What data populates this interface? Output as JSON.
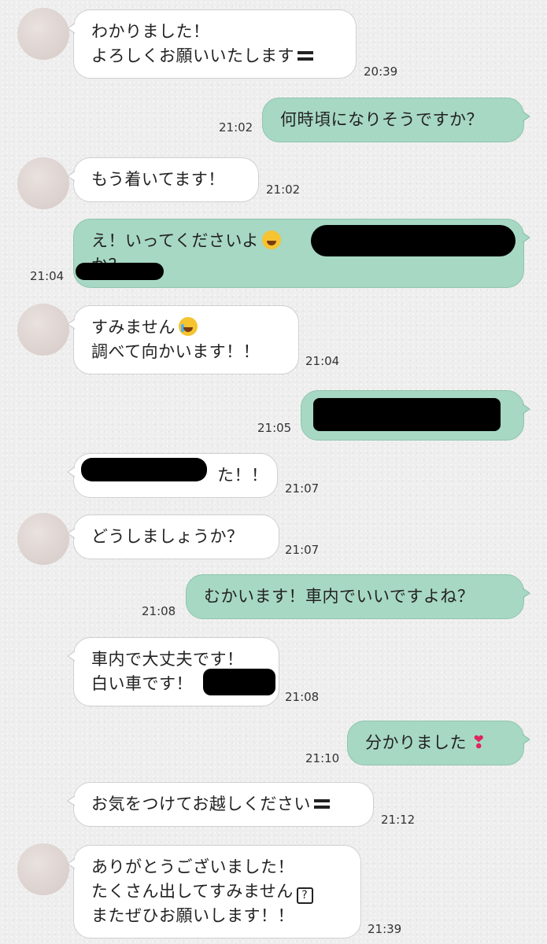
{
  "messages": [
    {
      "lines": [
        "わかりました！",
        "よろしくお願いいたします"
      ],
      "time": "20:39"
    },
    {
      "lines": [
        "何時頃になりそうですか？"
      ],
      "time": "21:02"
    },
    {
      "lines": [
        "もう着いてます！"
      ],
      "time": "21:02"
    },
    {
      "lines": [
        "え！いってくださいよ",
        "か？"
      ],
      "time": "21:04"
    },
    {
      "lines": [
        "すみません",
        "調べて向かいます！！"
      ],
      "time": "21:04"
    },
    {
      "lines": [
        ""
      ],
      "time": "21:05"
    },
    {
      "lines": [
        "た！！"
      ],
      "time": "21:07"
    },
    {
      "lines": [
        "どうしましょうか？"
      ],
      "time": "21:07"
    },
    {
      "lines": [
        "むかいます！車内でいいですよね？"
      ],
      "time": "21:08"
    },
    {
      "lines": [
        "車内で大丈夫です！",
        "白い車です！"
      ],
      "time": "21:08"
    },
    {
      "lines": [
        "分かりました"
      ],
      "time": "21:10"
    },
    {
      "lines": [
        "お気をつけてお越しください"
      ],
      "time": "21:12"
    },
    {
      "lines": [
        "ありがとうございました！",
        "たくさん出してすみません",
        "またぜひお願いします！！"
      ],
      "time": "21:39"
    }
  ],
  "icons": {
    "laugh": "face-with-tears-of-joy-icon",
    "cry": "loudly-crying-face-icon",
    "heart": "heavy-heart-exclamation-icon",
    "box": "question-box-icon",
    "bars": "equals-bars-icon"
  },
  "colors": {
    "incoming_bubble": "#ffffff",
    "outgoing_bubble": "#a7d8c3",
    "redaction": "#000000"
  }
}
